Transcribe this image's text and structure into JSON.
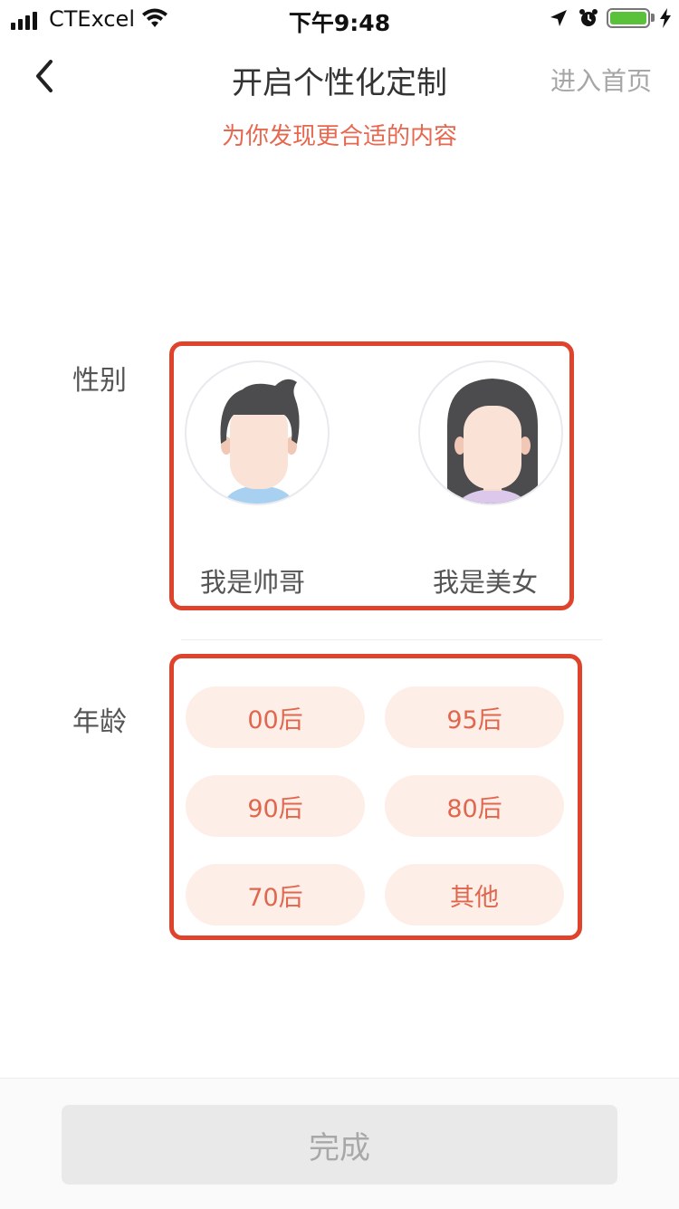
{
  "status_bar": {
    "carrier": "CTExcel",
    "time": "下午9:48",
    "battery_level": 1.0,
    "icons": [
      "signal-icon",
      "wifi-icon",
      "location-arrow-icon",
      "alarm-icon",
      "battery-icon",
      "charging-bolt-icon"
    ]
  },
  "nav": {
    "back_icon": "chevron-left-icon",
    "title": "开启个性化定制",
    "skip_label": "进入首页"
  },
  "subtitle": "为你发现更合适的内容",
  "gender": {
    "label": "性别",
    "options": [
      {
        "label": "我是帅哥",
        "icon": "male-avatar-icon"
      },
      {
        "label": "我是美女",
        "icon": "female-avatar-icon"
      }
    ]
  },
  "age": {
    "label": "年龄",
    "options": [
      "00后",
      "95后",
      "90后",
      "80后",
      "70后",
      "其他"
    ]
  },
  "footer": {
    "done_label": "完成"
  },
  "colors": {
    "accent": "#e0432b",
    "subtitle": "#e8674f",
    "chip_bg": "#fdeee8",
    "chip_text": "#e0674d",
    "button_bg": "#e9e9e9"
  }
}
